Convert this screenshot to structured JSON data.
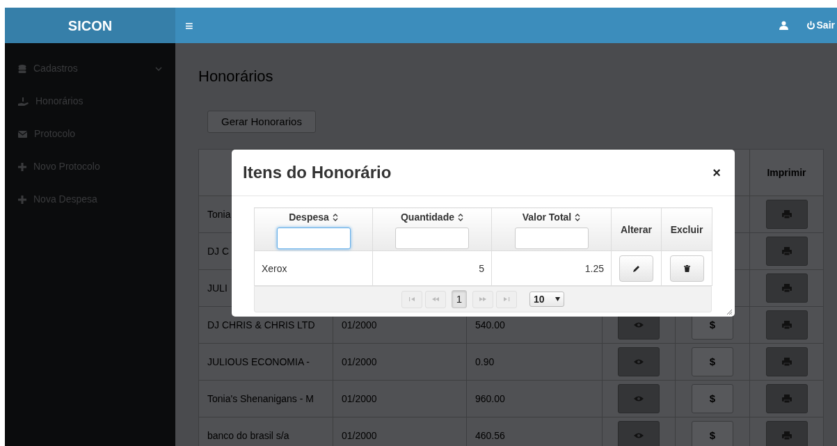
{
  "header": {
    "logo": "SICON",
    "menu_toggle": "≡",
    "logout": "Sair"
  },
  "sidebar": {
    "items": [
      {
        "label": "Cadastros",
        "kind": "group"
      },
      {
        "label": "Honorários",
        "kind": "link"
      },
      {
        "label": "Protocolo",
        "kind": "link"
      },
      {
        "label": "Novo Protocolo",
        "kind": "link"
      },
      {
        "label": "Nova Despesa",
        "kind": "link"
      }
    ]
  },
  "page": {
    "title": "Honorários",
    "action_button": "Gerar Honorarios"
  },
  "table": {
    "print_header": "Imprimir",
    "rows": [
      {
        "name": "Tonia"
      },
      {
        "name": "DJ C"
      },
      {
        "name": "JULI"
      },
      {
        "name": "DJ CHRIS & CHRIS LTD",
        "period": "01/2000",
        "value": "540.00",
        "currency_button": "$"
      },
      {
        "name": "JULIOUS ECONOMIA -",
        "period": "01/2000",
        "value": "0.90",
        "currency_button": "$"
      },
      {
        "name": "Tonia's Shenanigans - M",
        "period": "01/2000",
        "value": "960.00",
        "currency_button": "$"
      },
      {
        "name": "banco do brasil s/a",
        "period": "01/2000",
        "value": "460.56",
        "currency_button": "$"
      }
    ]
  },
  "modal": {
    "title": "Itens do Honorário",
    "close": "×",
    "columns": [
      {
        "label": "Despesa",
        "kind": "filter",
        "focused": true
      },
      {
        "label": "Quantidade",
        "kind": "filter",
        "focused": false
      },
      {
        "label": "Valor Total",
        "kind": "filter",
        "focused": false
      },
      {
        "label": "Alterar",
        "kind": "action"
      },
      {
        "label": "Excluir",
        "kind": "action"
      }
    ],
    "rows": [
      {
        "despesa": "Xerox",
        "quantidade": "5",
        "valor_total": "1.25"
      }
    ],
    "pager": {
      "pages": [
        {
          "label": "1",
          "selected": true
        }
      ],
      "page_size": "10"
    }
  }
}
